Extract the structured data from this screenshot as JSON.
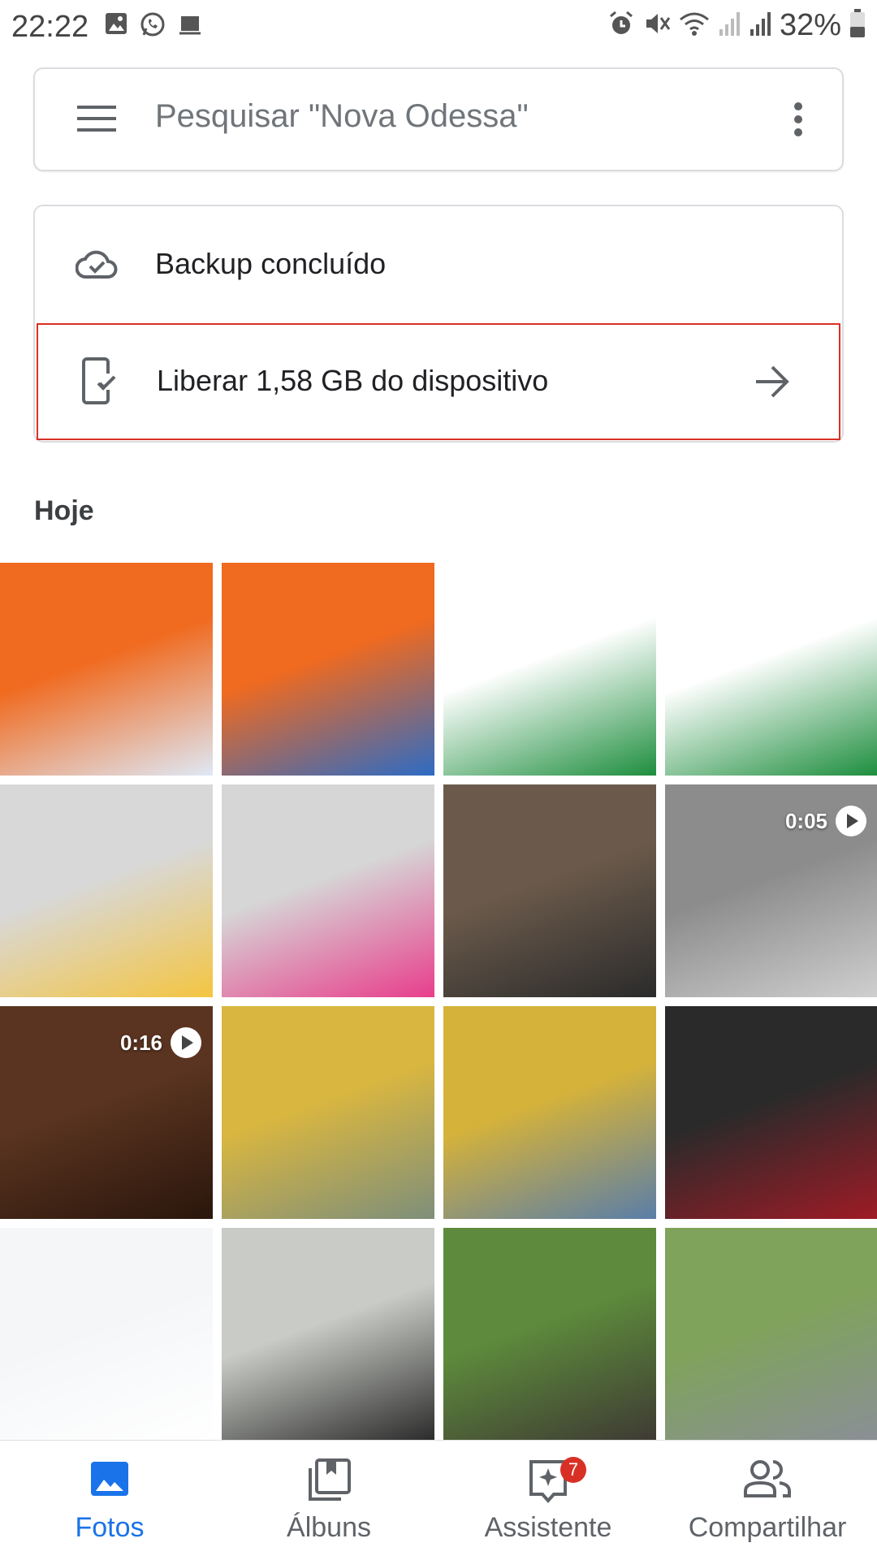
{
  "status_bar": {
    "time": "22:22",
    "battery": "32%",
    "left_icons": [
      "image-icon",
      "whatsapp-icon",
      "app-icon"
    ],
    "right_icons": [
      "alarm-icon",
      "mute-icon",
      "wifi-icon",
      "signal-icon",
      "signal-icon",
      "battery-icon"
    ]
  },
  "search": {
    "placeholder": "Pesquisar \"Nova Odessa\""
  },
  "backup": {
    "status_label": "Backup concluído",
    "free_space_label": "Liberar 1,58 GB do dispositivo"
  },
  "section": {
    "title": "Hoje"
  },
  "photos": [
    {
      "kind": "screenshot",
      "colors": [
        "#f06a1f",
        "#dfe8f5"
      ]
    },
    {
      "kind": "screenshot",
      "colors": [
        "#f06a1f",
        "#2d6bc4"
      ]
    },
    {
      "kind": "screenshot",
      "colors": [
        "#ffffff",
        "#1e8e3e"
      ]
    },
    {
      "kind": "screenshot",
      "colors": [
        "#ffffff",
        "#1e8e3e"
      ]
    },
    {
      "kind": "photo",
      "colors": [
        "#d8d8d8",
        "#f4c542"
      ]
    },
    {
      "kind": "photo",
      "colors": [
        "#d6d6d6",
        "#e83e8c"
      ]
    },
    {
      "kind": "photo",
      "colors": [
        "#6b5a4b",
        "#2b2b2b"
      ]
    },
    {
      "kind": "video",
      "duration": "0:05",
      "colors": [
        "#8c8c8c",
        "#cfcfcf"
      ]
    },
    {
      "kind": "video",
      "duration": "0:16",
      "colors": [
        "#5a3420",
        "#2a160c"
      ]
    },
    {
      "kind": "photo",
      "colors": [
        "#d9b640",
        "#7e8f7a"
      ]
    },
    {
      "kind": "photo",
      "colors": [
        "#d5b23a",
        "#5a7ea8"
      ]
    },
    {
      "kind": "photo",
      "colors": [
        "#2a2a2a",
        "#9e1b26"
      ]
    },
    {
      "kind": "screenshot",
      "colors": [
        "#f4f6f8",
        "#ffffff"
      ]
    },
    {
      "kind": "photo",
      "colors": [
        "#c9ccc6",
        "#2b2b2b"
      ]
    },
    {
      "kind": "photo",
      "colors": [
        "#5d8a3c",
        "#3e3a33"
      ]
    },
    {
      "kind": "photo",
      "colors": [
        "#7fa35a",
        "#8a8f96"
      ]
    }
  ],
  "bottom_nav": {
    "items": [
      {
        "label": "Fotos",
        "icon": "photo-icon",
        "active": true
      },
      {
        "label": "Álbuns",
        "icon": "albums-icon",
        "active": false
      },
      {
        "label": "Assistente",
        "icon": "assistant-icon",
        "active": false,
        "badge": "7"
      },
      {
        "label": "Compartilhar",
        "icon": "sharing-icon",
        "active": false
      }
    ]
  },
  "colors": {
    "accent": "#1a73e8",
    "highlight_border": "#d93025",
    "badge": "#d93025"
  }
}
